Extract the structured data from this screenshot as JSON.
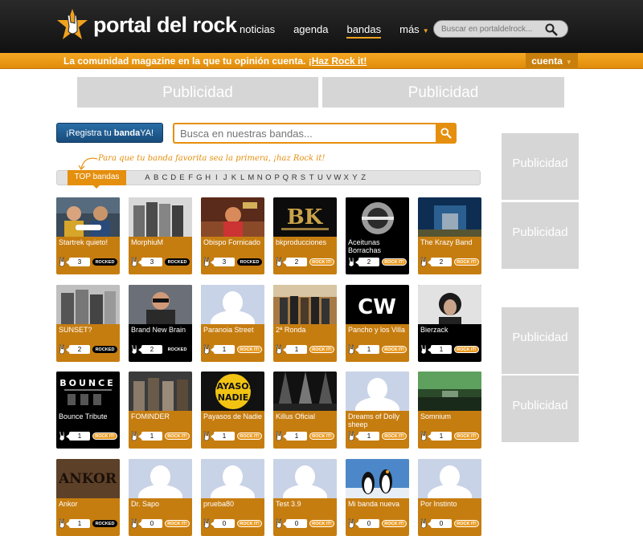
{
  "header": {
    "logo_text": "portal del rock",
    "nav": [
      {
        "label": "noticias",
        "active": false
      },
      {
        "label": "agenda",
        "active": false
      },
      {
        "label": "bandas",
        "active": true
      },
      {
        "label": "más",
        "active": false
      }
    ],
    "search_placeholder": "Buscar en portaldelrock..."
  },
  "bar": {
    "tagline_start": "La comunidad magazine en la que tu opinión cuenta. ",
    "tagline_link": "¡Haz Rock it!",
    "cuenta": "cuenta"
  },
  "ads": {
    "label": "Publicidad"
  },
  "register_button": {
    "pre": "¡Registra tu ",
    "bold": "banda",
    "post": "YA!"
  },
  "band_search": {
    "placeholder": "Busca en nuestras bandas..."
  },
  "hint": "Para que tu banda favorita sea la primera, ¡haz Rock it!",
  "az": {
    "top_tab": "TOP bandas",
    "letters": [
      "A",
      "B",
      "C",
      "D",
      "E",
      "F",
      "G",
      "H",
      "I",
      "J",
      "K",
      "L",
      "M",
      "N",
      "O",
      "P",
      "Q",
      "R",
      "S",
      "T",
      "U",
      "V",
      "W",
      "X",
      "Y",
      "Z"
    ]
  },
  "colors": {
    "accent": "#e58f0e",
    "card_orange": "#c67d10",
    "ad_gray": "#d6d6d6"
  },
  "bands": [
    {
      "name": "Startrek quieto!",
      "count": "3",
      "button": "ROCKED",
      "theme": "orange",
      "img": "startrek"
    },
    {
      "name": "MorphiuM",
      "count": "3",
      "button": "ROCKED",
      "theme": "orange",
      "img": "morphium"
    },
    {
      "name": "Obispo Fornicado",
      "count": "3",
      "button": "ROCKED",
      "theme": "orange",
      "img": "obispo"
    },
    {
      "name": "bkproducciones",
      "count": "2",
      "button": "ROCK IT!",
      "theme": "orange",
      "img": "bk"
    },
    {
      "name": "Aceitunas Borrachas",
      "count": "2",
      "button": "ROCK IT!",
      "theme": "black",
      "img": "aceitunas"
    },
    {
      "name": "The Krazy Band",
      "count": "2",
      "button": "ROCK IT!",
      "theme": "orange",
      "img": "krazy"
    },
    {
      "name": "SUNSET?",
      "count": "2",
      "button": "ROCKED",
      "theme": "orange",
      "img": "sunset"
    },
    {
      "name": "Brand New Brain",
      "count": "2",
      "button": "ROCKED",
      "theme": "black",
      "img": "brandnew"
    },
    {
      "name": "Paranoia Street",
      "count": "1",
      "button": "ROCK IT!",
      "theme": "orange",
      "img": "placeholder"
    },
    {
      "name": "2ª Ronda",
      "count": "1",
      "button": "ROCK IT!",
      "theme": "orange",
      "img": "ronda"
    },
    {
      "name": "Pancho y los Villa",
      "count": "1",
      "button": "ROCK IT!",
      "theme": "orange",
      "img": "pancho"
    },
    {
      "name": "Bierzack",
      "count": "1",
      "button": "ROCK IT!",
      "theme": "black",
      "img": "bierzack"
    },
    {
      "name": "Bounce Tribute",
      "count": "1",
      "button": "ROCK IT!",
      "theme": "black",
      "img": "bounce"
    },
    {
      "name": "FOMINDER",
      "count": "1",
      "button": "ROCK IT!",
      "theme": "orange",
      "img": "fominder"
    },
    {
      "name": "Payasos de Nadie",
      "count": "1",
      "button": "ROCK IT!",
      "theme": "orange",
      "img": "payasos"
    },
    {
      "name": "Killus Oficial",
      "count": "1",
      "button": "ROCK IT!",
      "theme": "orange",
      "img": "killus"
    },
    {
      "name": "Dreams of Dolly sheep",
      "count": "1",
      "button": "ROCK IT!",
      "theme": "orange",
      "img": "placeholder"
    },
    {
      "name": "Somnium",
      "count": "1",
      "button": "ROCK IT!",
      "theme": "orange",
      "img": "somnium"
    },
    {
      "name": "Ankor",
      "count": "1",
      "button": "ROCKED",
      "theme": "orange",
      "img": "ankor"
    },
    {
      "name": "Dr. Sapo",
      "count": "0",
      "button": "ROCK IT!",
      "theme": "orange",
      "img": "placeholder"
    },
    {
      "name": "prueba80",
      "count": "0",
      "button": "ROCK IT!",
      "theme": "orange",
      "img": "placeholder"
    },
    {
      "name": "Test 3.9",
      "count": "0",
      "button": "ROCK IT!",
      "theme": "orange",
      "img": "placeholder"
    },
    {
      "name": "Mi banda nueva",
      "count": "0",
      "button": "ROCK IT!",
      "theme": "orange",
      "img": "penguins"
    },
    {
      "name": "Por Instinto",
      "count": "0",
      "button": "ROCK IT!",
      "theme": "orange",
      "img": "placeholder"
    }
  ]
}
